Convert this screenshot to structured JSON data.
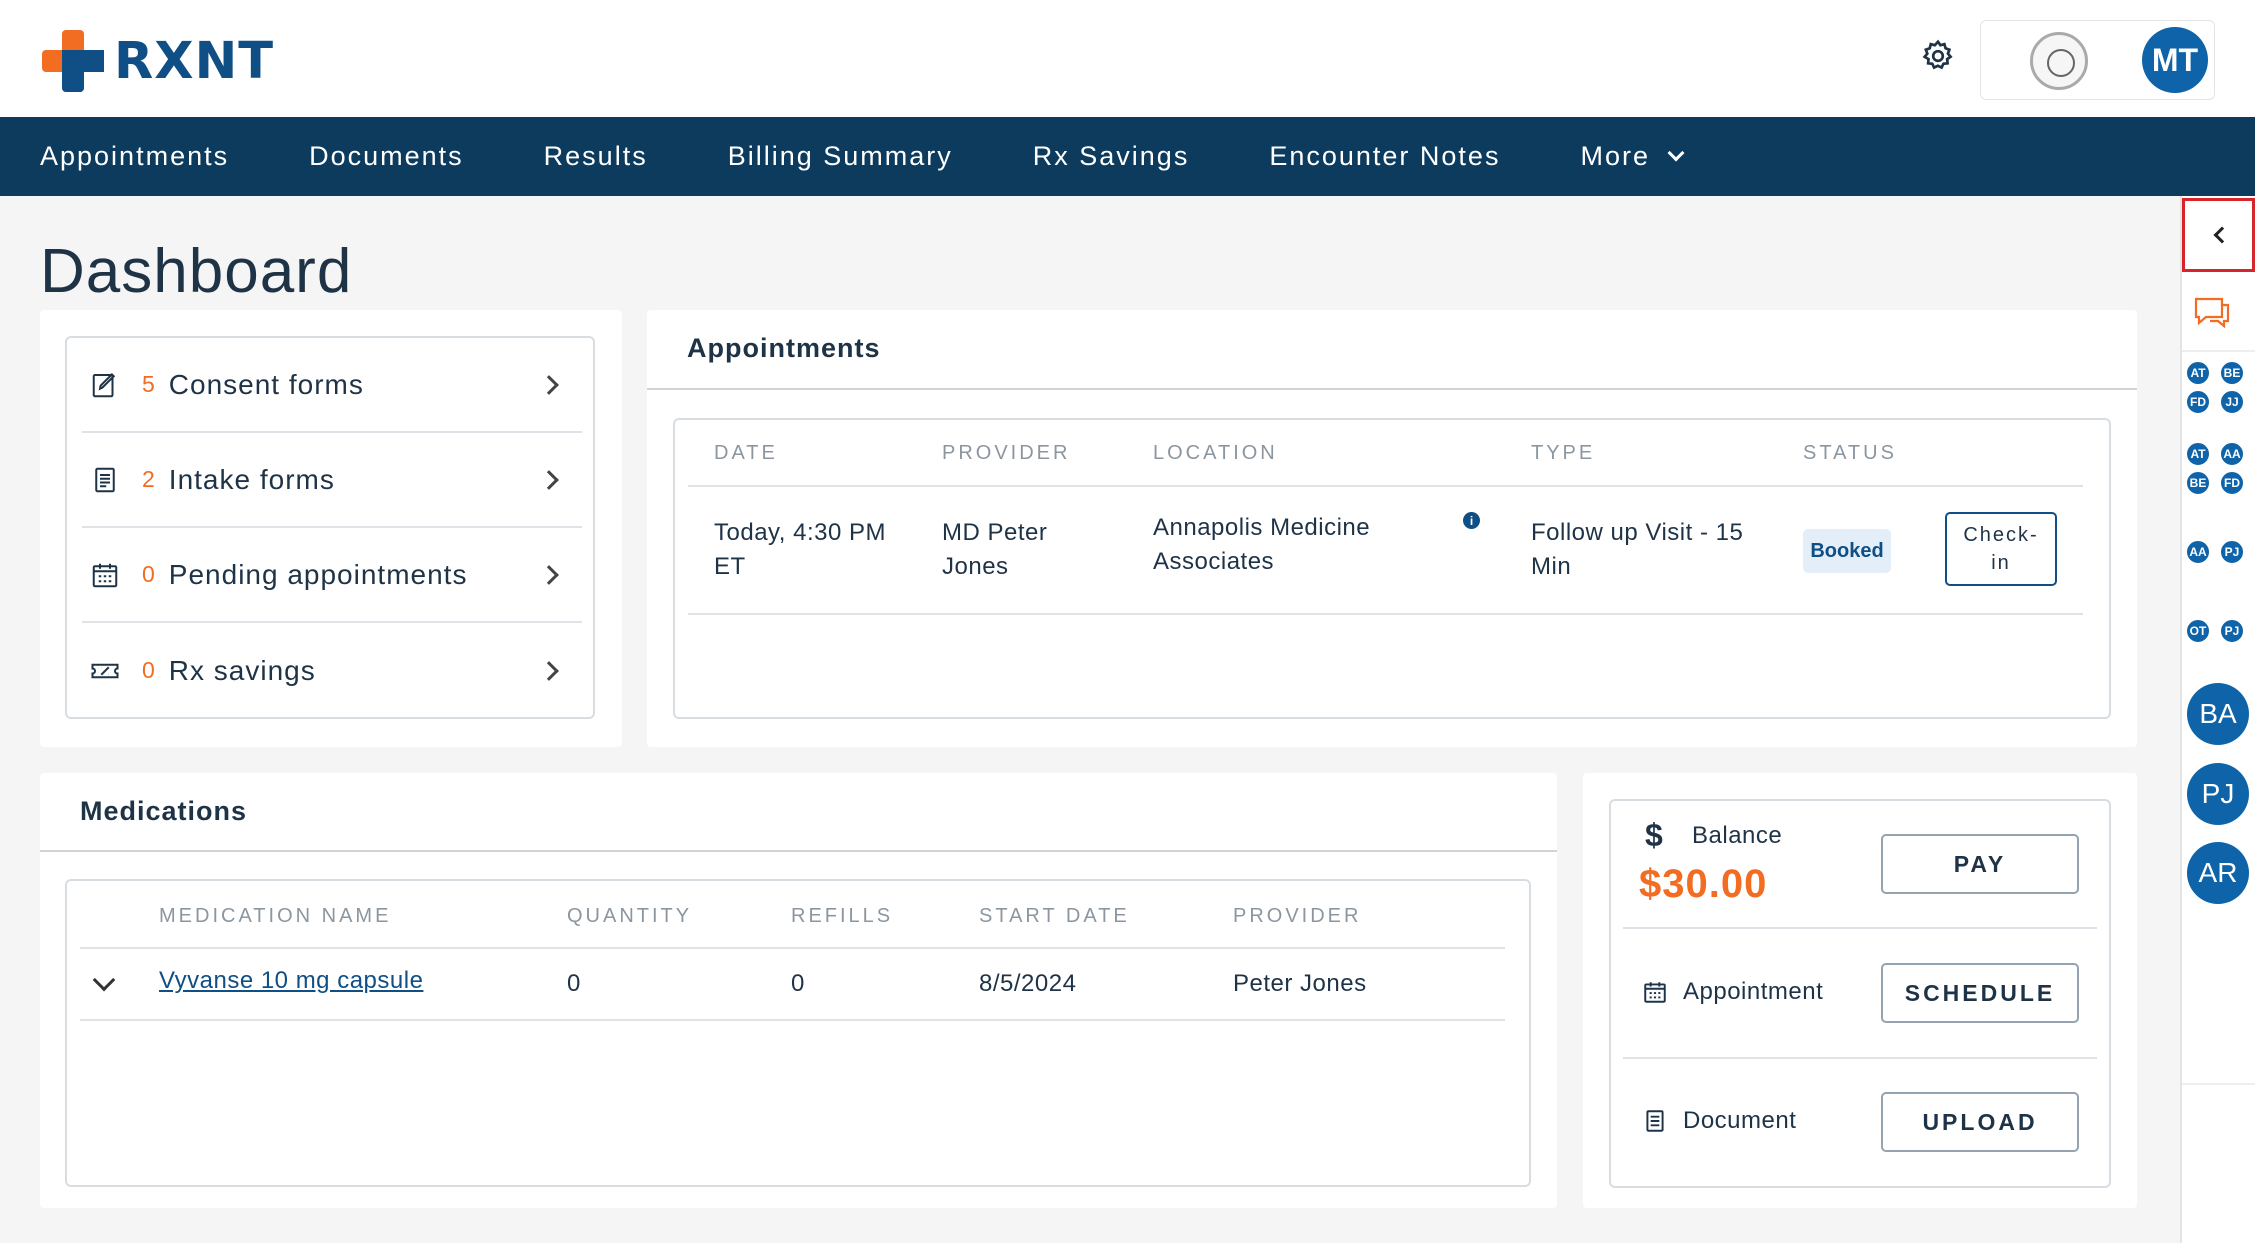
{
  "brand": {
    "name": "RXNT"
  },
  "header": {
    "avatar_initials": "MT"
  },
  "nav": {
    "items": [
      "Appointments",
      "Documents",
      "Results",
      "Billing Summary",
      "Rx Savings",
      "Encounter Notes",
      "More"
    ]
  },
  "page": {
    "title": "Dashboard"
  },
  "quick_links": [
    {
      "count": "5",
      "label": "Consent forms",
      "icon": "consent-form-icon"
    },
    {
      "count": "2",
      "label": "Intake forms",
      "icon": "intake-form-icon"
    },
    {
      "count": "0",
      "label": "Pending appointments",
      "icon": "calendar-icon"
    },
    {
      "count": "0",
      "label": "Rx savings",
      "icon": "rx-savings-icon"
    }
  ],
  "appointments": {
    "title": "Appointments",
    "headers": [
      "DATE",
      "PROVIDER",
      "LOCATION",
      "TYPE",
      "STATUS"
    ],
    "row": {
      "date_line1": "Today, 4:30 PM",
      "date_line2": "ET",
      "provider_line1": "MD Peter",
      "provider_line2": "Jones",
      "location_line1": "Annapolis Medicine",
      "location_line2": "Associates",
      "info": "i",
      "type_line1": "Follow up Visit - 15",
      "type_line2": "Min",
      "status": "Booked",
      "checkin_line1": "Check-",
      "checkin_line2": "in"
    }
  },
  "medications": {
    "title": "Medications",
    "headers": [
      "MEDICATION NAME",
      "QUANTITY",
      "REFILLS",
      "START DATE",
      "PROVIDER"
    ],
    "rows": [
      {
        "name": "Vyvanse 10 mg capsule",
        "quantity": "0",
        "refills": "0",
        "start_date": "8/5/2024",
        "provider": "Peter Jones"
      }
    ]
  },
  "actions": {
    "balance_symbol": "$",
    "balance_label": "Balance",
    "balance_value": "$30.00",
    "pay_label": "PAY",
    "appointment_label": "Appointment",
    "schedule_label": "SCHEDULE",
    "document_label": "Document",
    "upload_label": "UPLOAD"
  },
  "sidebar": {
    "groups": [
      [
        "AT",
        "BE",
        "FD",
        "JJ"
      ],
      [
        "AT",
        "AA",
        "BE",
        "FD"
      ],
      [
        "AA",
        "PJ"
      ],
      [
        "OT",
        "PJ"
      ]
    ],
    "avatars": [
      "BA",
      "PJ",
      "AR"
    ]
  },
  "colors": {
    "nav_bg": "#0c3b5e",
    "accent": "#f26c21",
    "primary": "#0f63a8",
    "highlight_border": "#d7262b"
  }
}
